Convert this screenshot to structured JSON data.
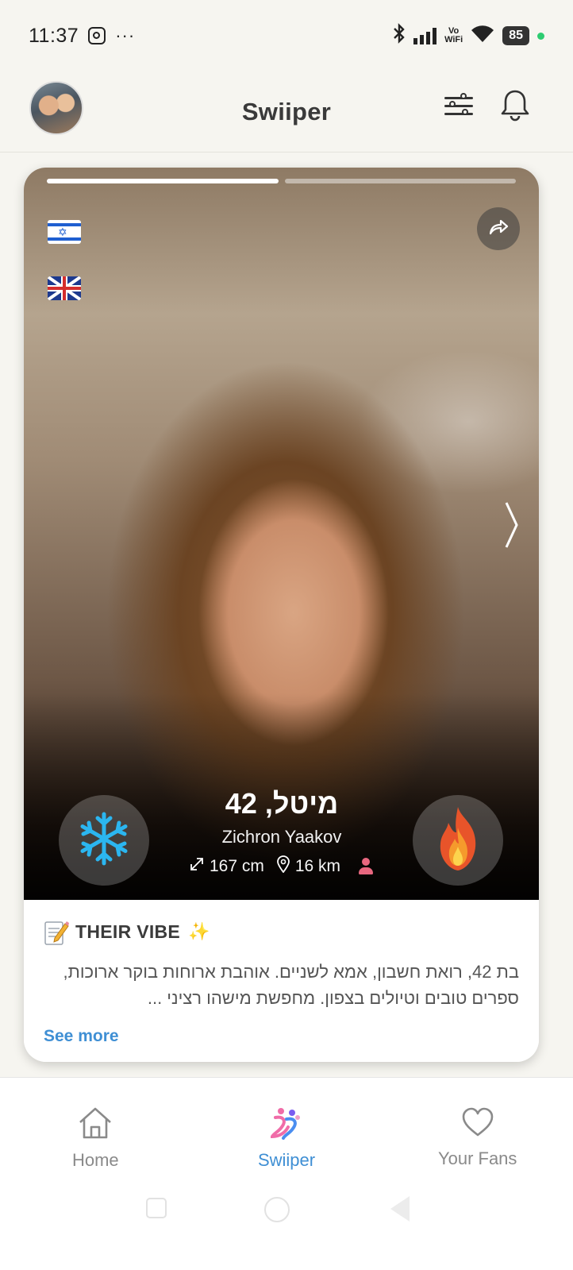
{
  "status_bar": {
    "time": "11:37",
    "more": "···",
    "vowifi_line1": "Vo",
    "vowifi_line2": "WiFi",
    "battery": "85"
  },
  "header": {
    "title": "Swiiper"
  },
  "profile": {
    "name_age": "מיטל, 42",
    "city": "Zichron Yaakov",
    "height": "167 cm",
    "distance": "16 km",
    "photo_count": 2,
    "active_photo_index": 0
  },
  "vibe": {
    "title": "THEIR VIBE",
    "sparkle": "✨",
    "text": "בת 42, רואת חשבון, אמא לשניים. אוהבת ארוחות בוקר ארוכות, ספרים טובים וטיולים בצפון. מחפשת מישהו רציני ...",
    "see_more": "See more"
  },
  "bottom_nav": {
    "items": [
      {
        "label": "Home",
        "icon": "home-icon",
        "active": false
      },
      {
        "label": "Swiiper",
        "icon": "swiiper-logo-icon",
        "active": true
      },
      {
        "label": "Your Fans",
        "icon": "heart-icon",
        "active": false
      }
    ]
  },
  "colors": {
    "accent": "#3f8fd4",
    "freeze": "#2bb6f0",
    "fire": "#e8542a",
    "person": "#e8677f"
  }
}
